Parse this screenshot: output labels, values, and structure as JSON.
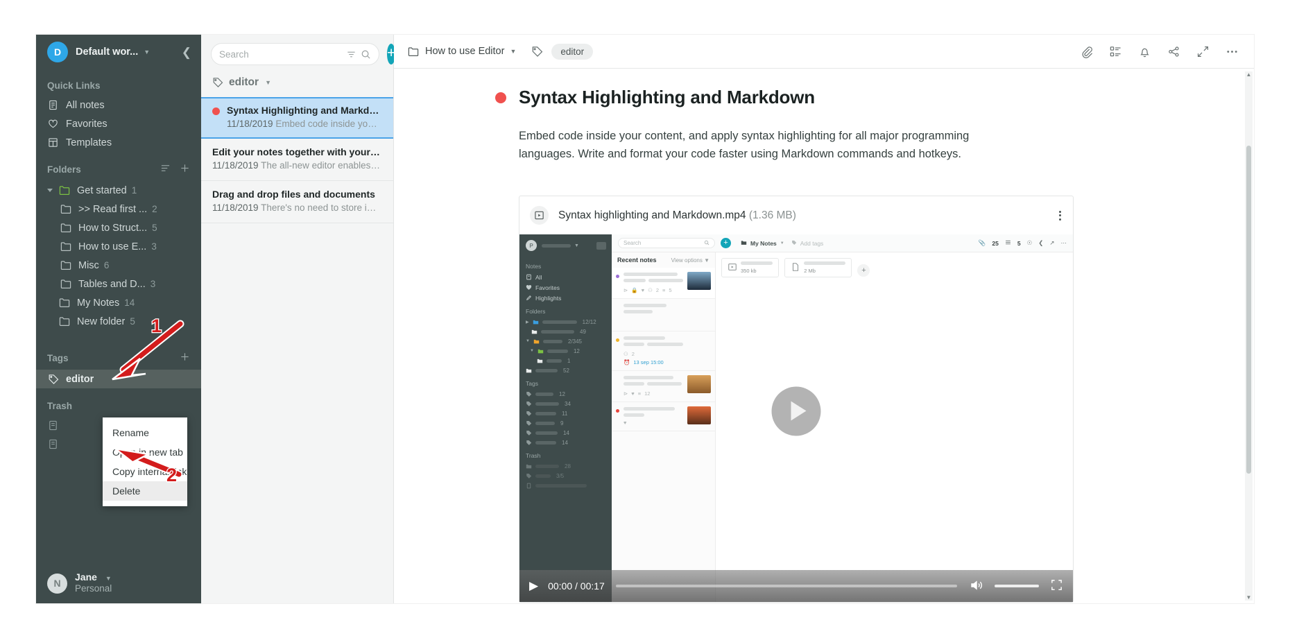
{
  "sidebar": {
    "workspace": {
      "avatar_letter": "D",
      "name": "Default wor...",
      "collapse_icon": "chevron-left-icon"
    },
    "quick_links_title": "Quick Links",
    "quick_links": [
      {
        "label": "All notes",
        "icon": "note-icon"
      },
      {
        "label": "Favorites",
        "icon": "heart-icon"
      },
      {
        "label": "Templates",
        "icon": "templates-icon"
      }
    ],
    "folders_title": "Folders",
    "folders": [
      {
        "label": "Get started",
        "count": "1",
        "indent": 0,
        "expanded": true,
        "color": "#7cc243"
      },
      {
        "label": ">> Read first ...",
        "count": "2",
        "indent": 1
      },
      {
        "label": "How to Struct...",
        "count": "5",
        "indent": 1
      },
      {
        "label": "How to use E...",
        "count": "3",
        "indent": 1
      },
      {
        "label": "Misc",
        "count": "6",
        "indent": 1
      },
      {
        "label": "Tables and D...",
        "count": "3",
        "indent": 1
      },
      {
        "label": "My Notes",
        "count": "14",
        "indent": 0
      },
      {
        "label": "New folder",
        "count": "5",
        "indent": 0
      }
    ],
    "tags_title": "Tags",
    "tags": [
      {
        "label": "editor",
        "selected": true
      }
    ],
    "trash_title": "Trash",
    "user": {
      "avatar_letter": "N",
      "name": "Jane",
      "plan": "Personal"
    }
  },
  "context_menu": {
    "items": [
      {
        "label": "Rename",
        "highlighted": false
      },
      {
        "label": "Open in new tab",
        "highlighted": false
      },
      {
        "label": "Copy internal link",
        "highlighted": false
      },
      {
        "label": "Delete",
        "highlighted": true
      }
    ]
  },
  "annotations": [
    {
      "number": "1",
      "target": "tag-editor"
    },
    {
      "number": "2",
      "target": "context-menu-delete"
    }
  ],
  "notelist": {
    "search": {
      "placeholder": "Search",
      "value": "",
      "filter_icon": "filter-icon",
      "search_icon": "search-icon"
    },
    "add_button": "+",
    "filter_tag": "editor",
    "notes": [
      {
        "title": "Syntax Highlighting and Markdown",
        "date": "11/18/2019",
        "excerpt": "Embed code inside your cont...",
        "active": true,
        "dot_color": "#f0514e"
      },
      {
        "title": "Edit your notes together with your t...",
        "date": "11/18/2019",
        "excerpt": "The all-new editor enables y...",
        "active": false
      },
      {
        "title": "Drag and drop files and documents",
        "date": "11/18/2019",
        "excerpt": "There's no need to store imp...",
        "active": false
      }
    ]
  },
  "editor": {
    "breadcrumb_folder": "How to use Editor",
    "tag_chip": "editor",
    "toolbar": [
      {
        "name": "attachment-icon"
      },
      {
        "name": "task-list-icon"
      },
      {
        "name": "reminder-bell-icon"
      },
      {
        "name": "share-icon"
      },
      {
        "name": "expand-icon"
      },
      {
        "name": "more-options-icon"
      }
    ],
    "note_title": "Syntax Highlighting and Markdown",
    "note_dot_color": "#f0514e",
    "paragraph": "Embed code inside your content, and apply syntax highlighting for all major programming languages. Write and format your code faster using Markdown commands and hotkeys.",
    "attachment": {
      "filename": "Syntax highlighting and Markdown.mp4",
      "size": "(1.36 MB)",
      "icon": "video-file-icon",
      "kebab": "more-options-icon"
    },
    "video": {
      "current_time": "00:00",
      "duration": "00:17",
      "time_display": "00:00 / 00:17",
      "play_icon": "play-icon",
      "volume_icon": "volume-icon",
      "fullscreen_icon": "fullscreen-icon"
    }
  },
  "video_poster": {
    "sidebar": {
      "avatar_letter": "P",
      "notes_title": "Notes",
      "notes_items": [
        "All",
        "Favorites",
        "Highlights"
      ],
      "folders_title": "Folders",
      "folders_counts": [
        "12/12",
        "49",
        "2/345",
        "12",
        "1",
        "52"
      ],
      "tags_title": "Tags",
      "tags_counts": [
        "12",
        "34",
        "11",
        "9",
        "14",
        "14"
      ],
      "trash_title": "Trash",
      "trash_counts": [
        "28",
        "3/5"
      ]
    },
    "main": {
      "search_placeholder": "Search",
      "list_title": "Recent notes",
      "view_options": "View options",
      "breadcrumb": "My Notes",
      "add_tags": "Add tags",
      "counts": [
        "25",
        "5"
      ],
      "attachments": [
        {
          "size": "350 kb"
        },
        {
          "size": "2 Mb"
        }
      ],
      "card_meta": [
        "2",
        "5",
        "2",
        "12"
      ],
      "reminder": "13 sep 15:00"
    }
  }
}
